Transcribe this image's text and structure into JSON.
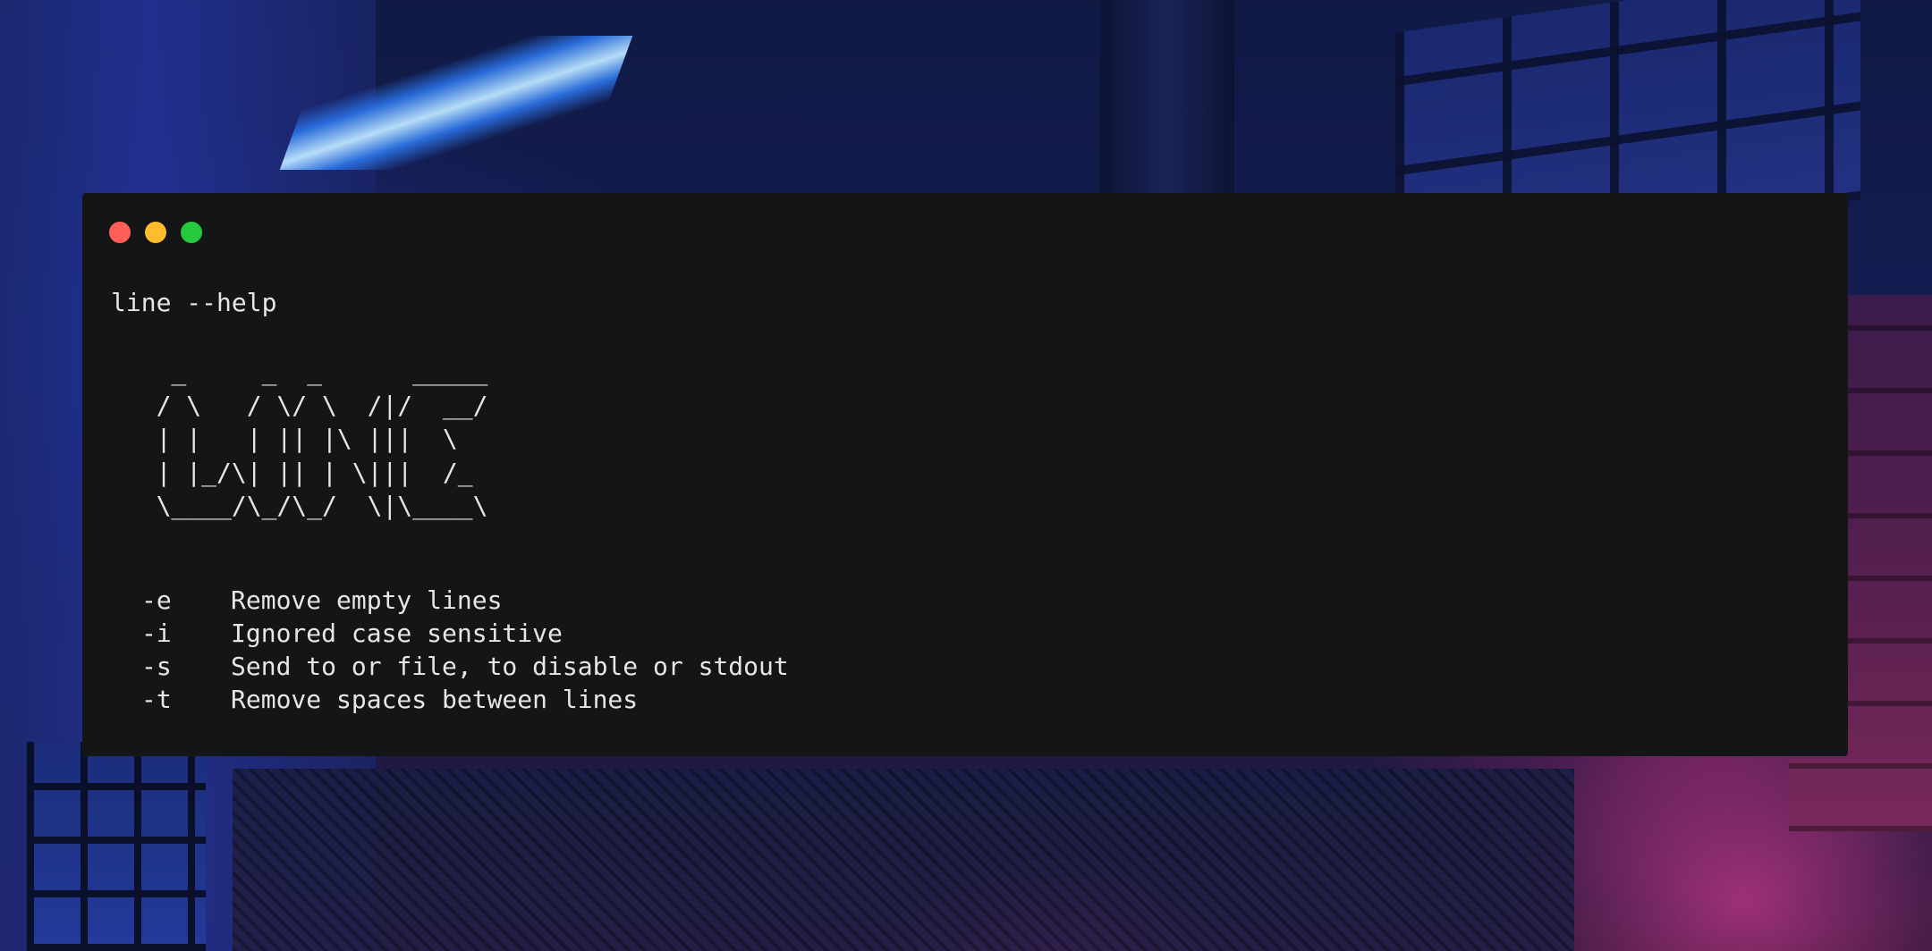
{
  "terminal": {
    "command": "line --help",
    "ascii_art": "    _     _  _      _____\n   / \\   / \\/ \\  /|/  __/\n   | |   | || |\\ |||  \\  \n   | |_/\\| || | \\|||  /_ \n   \\____/\\_/\\_/  \\|\\____\\",
    "options": [
      {
        "flag": "-e",
        "description": "Remove empty lines"
      },
      {
        "flag": "-i",
        "description": "Ignored case sensitive"
      },
      {
        "flag": "-s",
        "description": "Send to or file, to disable or stdout"
      },
      {
        "flag": "-t",
        "description": "Remove spaces between lines"
      }
    ]
  },
  "colors": {
    "terminal_background": "#141516",
    "text": "#e6e6e6",
    "close": "#ff5f56",
    "minimize": "#ffbd2e",
    "maximize": "#27c93f"
  }
}
